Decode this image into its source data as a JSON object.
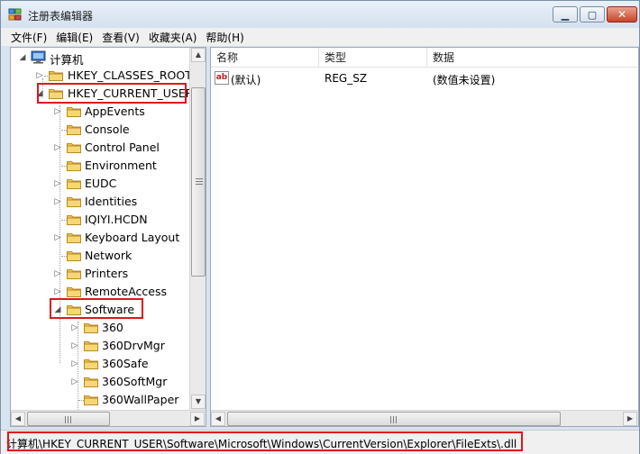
{
  "window": {
    "title": "注册表编辑器",
    "min_glyph": "▁",
    "max_glyph": "▢",
    "close_glyph": "✕"
  },
  "menu": [
    "文件(F)",
    "编辑(E)",
    "查看(V)",
    "收藏夹(A)",
    "帮助(H)"
  ],
  "tree": {
    "root": "计算机",
    "hives": [
      "HKEY_CLASSES_ROOT",
      "HKEY_CURRENT_USER"
    ],
    "current_user_children": [
      "AppEvents",
      "Console",
      "Control Panel",
      "Environment",
      "EUDC",
      "Identities",
      "IQIYI.HCDN",
      "Keyboard Layout",
      "Network",
      "Printers",
      "RemoteAccess",
      "Software"
    ],
    "software_children": [
      "360",
      "360DrvMgr",
      "360Safe",
      "360SoftMgr",
      "360WallPaper"
    ]
  },
  "list": {
    "columns": [
      "名称",
      "类型",
      "数据"
    ],
    "rows": [
      {
        "name": "(默认)",
        "type": "REG_SZ",
        "data": "(数值未设置)"
      }
    ]
  },
  "status": {
    "path": "计算机\\HKEY_CURRENT_USER\\Software\\Microsoft\\Windows\\CurrentVersion\\Explorer\\FileExts\\.dll"
  },
  "scroll": {
    "up": "▲",
    "down": "▼",
    "left": "◀",
    "right": "▶"
  },
  "colors": {
    "highlight": "#e0161b",
    "folder": "#f2c64a"
  },
  "icons": {
    "app": "registry-editor-icon",
    "computer": "computer-icon",
    "folder": "folder-icon",
    "value": "string-value-icon",
    "value_glyph": "ab"
  }
}
